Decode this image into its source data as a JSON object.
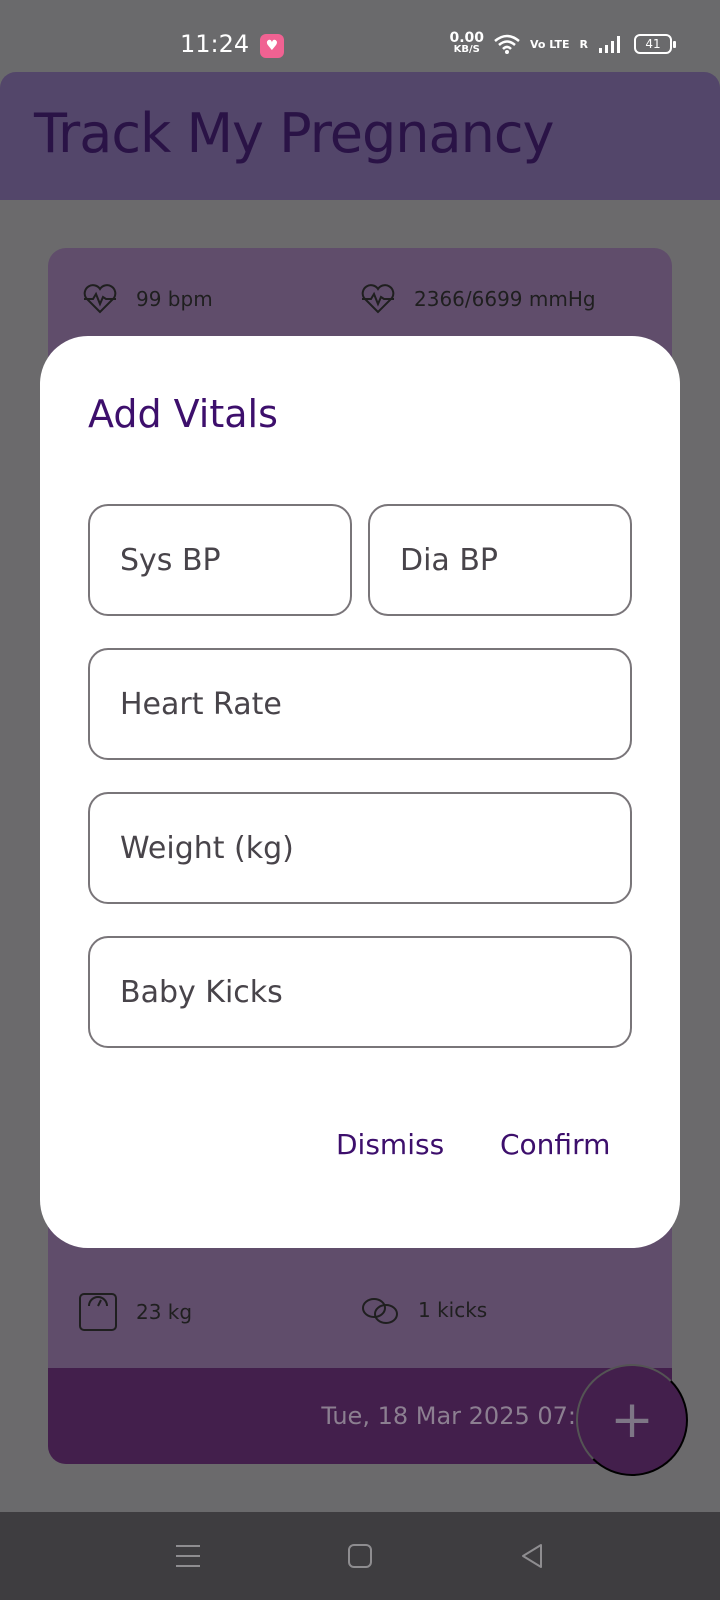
{
  "status_bar": {
    "time": "11:24",
    "net_speed_value": "0.00",
    "net_speed_unit": "KB/S",
    "volte": "Vo LTE",
    "roaming": "R",
    "battery": "41"
  },
  "app": {
    "title": "Track My Pregnancy"
  },
  "card": {
    "heart_rate": "99 bpm",
    "blood_pressure": "2366/6699 mmHg",
    "weight": "23 kg",
    "kicks": "1 kicks",
    "date": "Tue, 18 Mar 2025 07:"
  },
  "fab": {
    "label": "+"
  },
  "dialog": {
    "title": "Add Vitals",
    "fields": {
      "sys_bp": "Sys BP",
      "dia_bp": "Dia BP",
      "heart_rate": "Heart Rate",
      "weight": "Weight (kg)",
      "baby_kicks": "Baby Kicks"
    },
    "dismiss": "Dismiss",
    "confirm": "Confirm"
  },
  "colors": {
    "accent": "#3d0f6c",
    "appbar": "#53466a",
    "card": "#604d6b",
    "card_footer": "#431f4c",
    "scrim": "#6a6a6c"
  },
  "icons": {
    "heart_rate": "heart-pulse-icon",
    "blood_pressure": "heart-pulse-icon",
    "weight": "scale-icon",
    "kicks": "baby-feet-icon",
    "nav_menu": "menu-icon",
    "nav_home": "square-home-icon",
    "nav_back": "triangle-back-icon"
  }
}
